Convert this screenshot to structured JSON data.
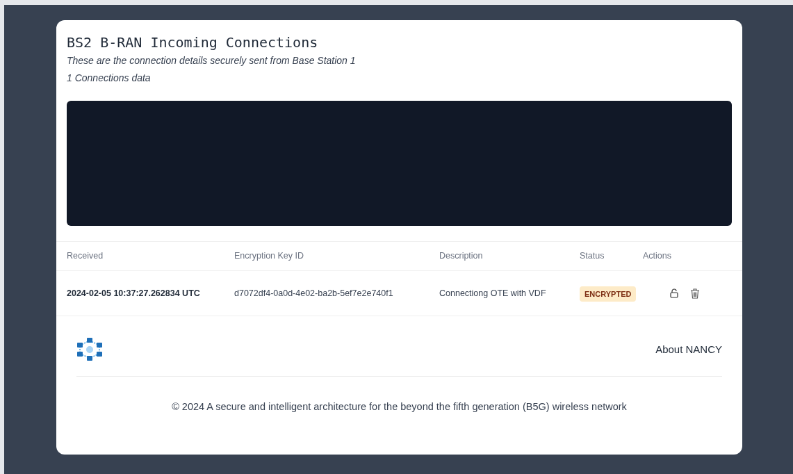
{
  "header": {
    "title": "BS2 B-RAN Incoming Connections",
    "subtitle": "These are the connection details securely sent from Base Station 1",
    "count": "1 Connections data"
  },
  "table": {
    "columns": [
      "Received",
      "Encryption Key ID",
      "Description",
      "Status",
      "Actions"
    ],
    "rows": [
      {
        "received": "2024-02-05 10:37:27.262834 UTC",
        "key_id": "d7072df4-0a0d-4e02-ba2b-5ef7e2e740f1",
        "description": "Connectiong OTE with VDF",
        "status": "ENCRYPTED"
      }
    ]
  },
  "footer": {
    "link": "About NANCY",
    "copyright": "© 2024 A secure and intelligent architecture for the beyond the fifth generation (B5G) wireless network"
  }
}
